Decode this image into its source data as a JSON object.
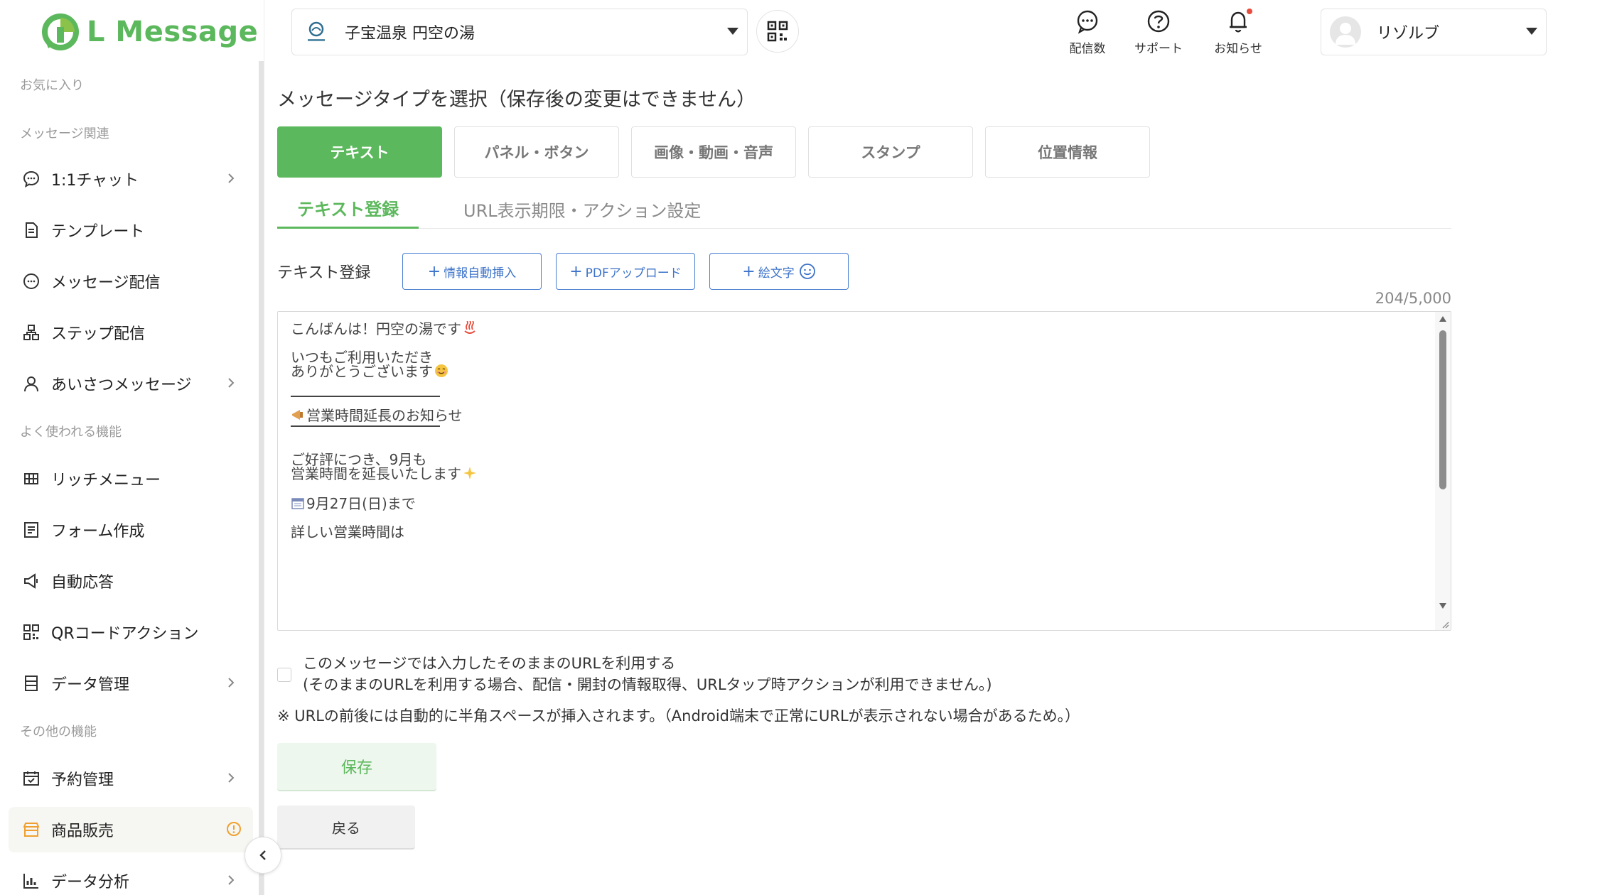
{
  "app": {
    "logo_text": "L Message",
    "brand_color": "#5cb85c",
    "link_color": "#3d73c9"
  },
  "sidebar": {
    "sections": {
      "favorites": "お気に入り",
      "message": "メッセージ関連",
      "frequent": "よく使われる機能",
      "other": "その他の機能"
    },
    "items": [
      {
        "label": "1:1チャット",
        "icon": "chat-icon",
        "has_chevron": true
      },
      {
        "label": "テンプレート",
        "icon": "document-icon",
        "has_chevron": false
      },
      {
        "label": "メッセージ配信",
        "icon": "message-icon",
        "has_chevron": false
      },
      {
        "label": "ステップ配信",
        "icon": "step-icon",
        "has_chevron": false
      },
      {
        "label": "あいさつメッセージ",
        "icon": "user-icon",
        "has_chevron": true
      },
      {
        "label": "リッチメニュー",
        "icon": "grid-icon",
        "has_chevron": false
      },
      {
        "label": "フォーム作成",
        "icon": "form-icon",
        "has_chevron": false
      },
      {
        "label": "自動応答",
        "icon": "megaphone-icon",
        "has_chevron": false
      },
      {
        "label": "QRコードアクション",
        "icon": "qr-icon",
        "has_chevron": false
      },
      {
        "label": "データ管理",
        "icon": "database-icon",
        "has_chevron": true
      },
      {
        "label": "予約管理",
        "icon": "calendar-icon",
        "has_chevron": true
      },
      {
        "label": "商品販売",
        "icon": "store-icon",
        "has_chevron": false,
        "active": true
      },
      {
        "label": "データ分析",
        "icon": "bar-chart-icon",
        "has_chevron": true
      }
    ]
  },
  "header": {
    "account_name": "子宝温泉 円空の湯",
    "icons": [
      {
        "label": "配信数",
        "icon": "message-count-icon"
      },
      {
        "label": "サポート",
        "icon": "help-icon"
      },
      {
        "label": "お知らせ",
        "icon": "bell-icon"
      }
    ],
    "user_name": "リゾルブ"
  },
  "main": {
    "title": "メッセージタイプを選択（保存後の変更はできません）",
    "types": [
      "テキスト",
      "パネル・ボタン",
      "画像・動画・音声",
      "スタンプ",
      "位置情報"
    ],
    "selected_type": "テキスト",
    "tabs": [
      "テキスト登録",
      "URL表示期限・アクション設定"
    ],
    "active_tab": "テキスト登録",
    "field_label": "テキスト登録",
    "insert_buttons": {
      "auto_insert": "情報自動挿入",
      "pdf_upload": "PDFアップロード",
      "emoji": "絵文字"
    },
    "counter": "204/5,000",
    "text_lines": {
      "l1": "こんばんは！円空の湯です",
      "l2": "いつもご利用いただき",
      "l3": "ありがとうございます",
      "l4": "営業時間延長のお知らせ",
      "l5": "ご好評につき、9月も",
      "l6": "営業時間を延長いたします",
      "l7": "9月27日(日)まで",
      "l8": "詳しい営業時間は"
    },
    "url_option": {
      "line1": "このメッセージでは入力したそのままのURLを利用する",
      "line2": "(そのままのURLを利用する場合、配信・開封の情報取得、URLタップ時アクションが利用できません。)"
    },
    "note": "※ URLの前後には自動的に半角スペースが挿入されます。（Android端末で正常にURLが表示されない場合があるため。）",
    "save_label": "保存",
    "back_label": "戻る"
  }
}
